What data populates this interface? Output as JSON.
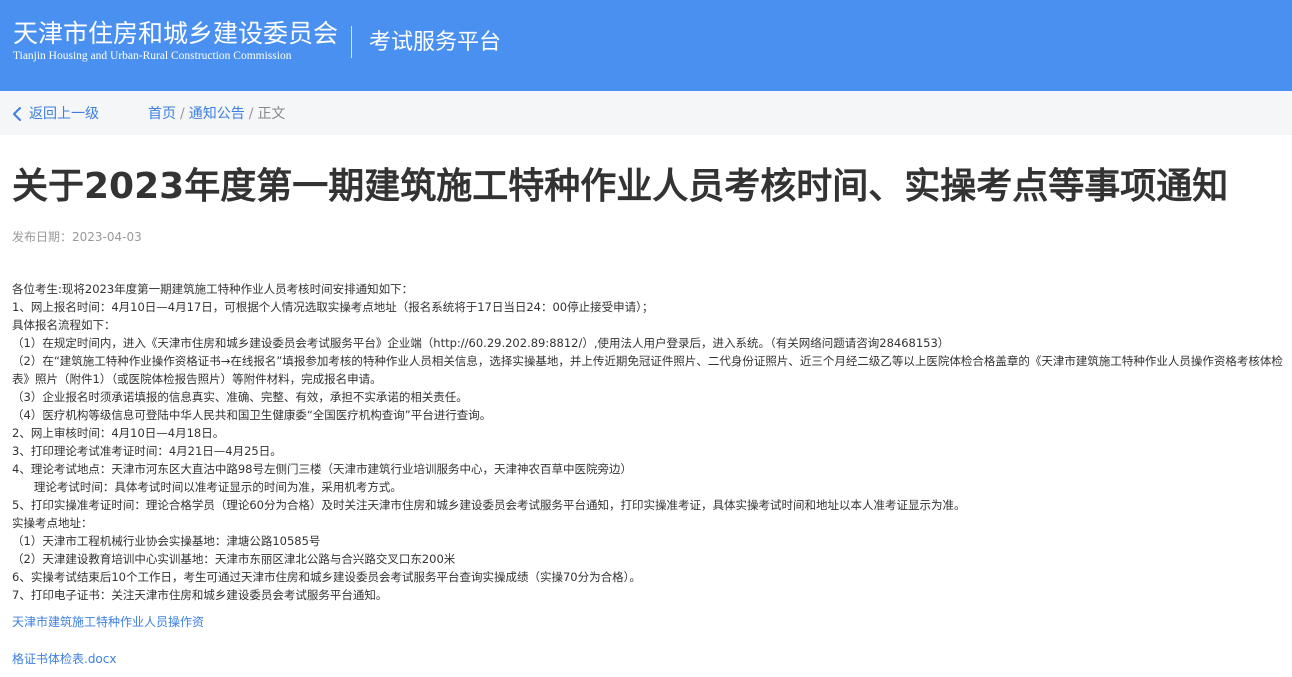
{
  "header": {
    "org_name_cn": "天津市住房和城乡建设委员会",
    "org_name_en": "Tianjin Housing and Urban-Rural Construction Commission",
    "platform_name": "考试服务平台"
  },
  "nav": {
    "back_label": "返回上一级",
    "breadcrumb": {
      "home": "首页",
      "notices": "通知公告",
      "current": "正文",
      "separator": "/"
    }
  },
  "article": {
    "title": "关于2023年度第一期建筑施工特种作业人员考核时间、实操考点等事项通知",
    "publish_date": "发布日期：2023-04-03",
    "lines": [
      "各位考生:现将2023年度第一期建筑施工特种作业人员考核时间安排通知如下：",
      "1、网上报名时间：4月10日—4月17日，可根据个人情况选取实操考点地址（报名系统将于17日当日24：00停止接受申请）；",
      "具体报名流程如下：",
      "（1）在规定时间内，进入《天津市住房和城乡建设委员会考试服务平台》企业端（http://60.29.202.89:8812/）,使用法人用户登录后，进入系统。（有关网络问题请咨询28468153）",
      "（2）在“建筑施工特种作业操作资格证书→在线报名”填报参加考核的特种作业人员相关信息，选择实操基地，并上传近期免冠证件照片、二代身份证照片、近三个月经二级乙等以上医院体检合格盖章的《天津市建筑施工特种作业人员操作资格考核体检表》照片（附件1）（或医院体检报告照片）等附件材料，完成报名申请。",
      "（3）企业报名时须承诺填报的信息真实、准确、完整、有效，承担不实承诺的相关责任。",
      "（4）医疗机构等级信息可登陆中华人民共和国卫生健康委“全国医疗机构查询”平台进行查询。",
      "2、网上审核时间：4月10日—4月18日。",
      "3、打印理论考试准考证时间：4月21日—4月25日。",
      "4、理论考试地点：天津市河东区大直沽中路98号左侧门三楼（天津市建筑行业培训服务中心，天津神农百草中医院旁边）",
      "      理论考试时间：具体考试时间以准考证显示的时间为准，采用机考方式。",
      "5、打印实操准考证时间：理论合格学员（理论60分为合格）及时关注天津市住房和城乡建设委员会考试服务平台通知，打印实操准考证，具体实操考试时间和地址以本人准考证显示为准。",
      "实操考点地址：",
      "（1）天津市工程机械行业协会实操基地：津塘公路10585号",
      "（2）天津建设教育培训中心实训基地：天津市东丽区津北公路与合兴路交叉口东200米",
      "6、实操考试结束后10个工作日，考生可通过天津市住房和城乡建设委员会考试服务平台查询实操成绩（实操70分为合格）。",
      "7、打印电子证书：关注天津市住房和城乡建设委员会考试服务平台通知。"
    ],
    "attachments": [
      "天津市建筑施工特种作业人员操作资",
      "格证书体检表.docx"
    ]
  },
  "colors": {
    "header_bg": "#4a90f0",
    "link": "#3d7fe0",
    "crumb_bar_bg": "#f5f6f8"
  }
}
